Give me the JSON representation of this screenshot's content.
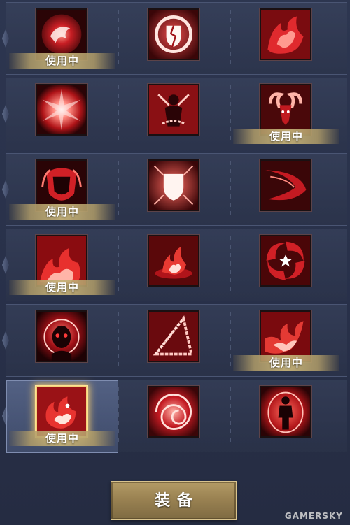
{
  "in_use_label": "使用中",
  "equip_button_label": "装备",
  "watermark": "GAMERSKY",
  "rows": [
    {
      "slots": [
        {
          "icon": "swirl-orb-skill-icon",
          "in_use": true
        },
        {
          "icon": "cracked-shield-skill-icon",
          "in_use": false
        },
        {
          "icon": "flame-cluster-skill-icon",
          "in_use": false
        }
      ]
    },
    {
      "slots": [
        {
          "icon": "light-burst-skill-icon",
          "in_use": false
        },
        {
          "icon": "chained-figure-skill-icon",
          "in_use": false
        },
        {
          "icon": "ram-horn-skill-icon",
          "in_use": true
        }
      ]
    },
    {
      "slots": [
        {
          "icon": "flaming-armor-skill-icon",
          "in_use": true
        },
        {
          "icon": "glowing-shield-skill-icon",
          "in_use": false
        },
        {
          "icon": "dash-strike-skill-icon",
          "in_use": false
        }
      ]
    },
    {
      "slots": [
        {
          "icon": "fire-wave-skill-icon",
          "in_use": true
        },
        {
          "icon": "flame-blast-skill-icon",
          "in_use": false
        },
        {
          "icon": "vortex-star-skill-icon",
          "in_use": false
        }
      ]
    },
    {
      "slots": [
        {
          "icon": "skull-aura-skill-icon",
          "in_use": false
        },
        {
          "icon": "chain-triangle-skill-icon",
          "in_use": false
        },
        {
          "icon": "fire-claw-skill-icon",
          "in_use": true
        }
      ]
    },
    {
      "slots": [
        {
          "icon": "fire-bird-skill-icon",
          "in_use": true,
          "selected": true
        },
        {
          "icon": "red-vortex-skill-icon",
          "in_use": false
        },
        {
          "icon": "burning-warrior-skill-icon",
          "in_use": false
        }
      ]
    }
  ],
  "colors": {
    "background": "#2a3247",
    "accent_gold": "#b49c66",
    "skill_red": "#c41a22"
  }
}
